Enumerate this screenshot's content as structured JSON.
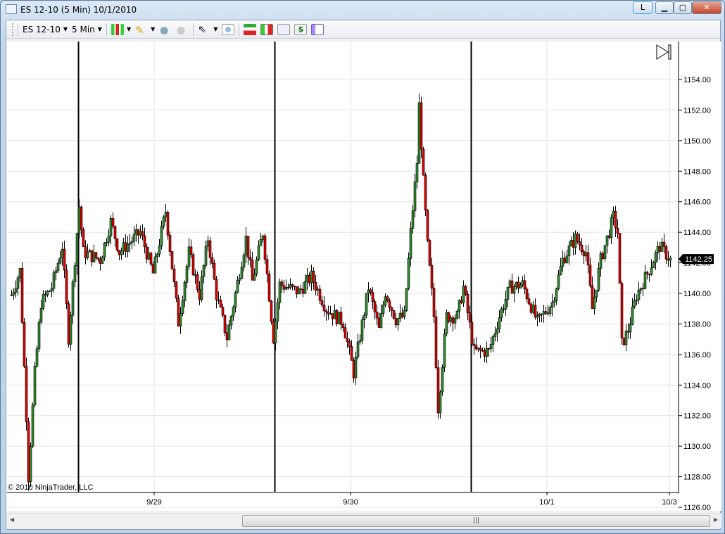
{
  "window": {
    "title": "ES 12-10 (5 Min)  10/1/2010",
    "link_button": "L"
  },
  "toolbar": {
    "instrument": "ES 12-10",
    "interval": "5 Min",
    "icons": [
      "chart-style-icon",
      "drawing-pencil-icon",
      "zoom-in-icon",
      "zoom-out-icon",
      "cursor-icon",
      "magnify-icon",
      "strategies-icon",
      "indicators-icon",
      "data-box-icon",
      "order-icon",
      "properties-icon"
    ]
  },
  "chart": {
    "copyright": "© 2010 NinjaTrader, LLC",
    "last_price": "1142.25",
    "up_color": "#2e8b2e",
    "down_color": "#e00000",
    "wick_color": "#000000",
    "last_price_bg": "#000000"
  },
  "chart_data": {
    "type": "candlestick",
    "ylim": [
      1126,
      1154
    ],
    "y_ticks": [
      "1126.00",
      "1128.00",
      "1130.00",
      "1132.00",
      "1134.00",
      "1136.00",
      "1138.00",
      "1140.00",
      "1142.00",
      "1144.00",
      "1146.00",
      "1148.00",
      "1150.00",
      "1152.00",
      "1154.00"
    ],
    "x_ticks": [
      {
        "label": "9/29",
        "bar": 69
      },
      {
        "label": "9/30",
        "bar": 162
      },
      {
        "label": "10/1",
        "bar": 255
      },
      {
        "label": "10/3",
        "bar": 313
      }
    ],
    "session_breaks": [
      33,
      126,
      219
    ],
    "grid": true,
    "price_path": [
      [
        1,
        1139.9
      ],
      [
        5,
        1141.5
      ],
      [
        8,
        1132
      ],
      [
        9,
        1128
      ],
      [
        12,
        1134.8
      ],
      [
        15,
        1139.4
      ],
      [
        20,
        1140.4
      ],
      [
        25,
        1143.1
      ],
      [
        28,
        1137.1
      ],
      [
        33,
        1145.7
      ],
      [
        35,
        1142.7
      ],
      [
        43,
        1142.2
      ],
      [
        48,
        1144.7
      ],
      [
        52,
        1142.7
      ],
      [
        62,
        1144
      ],
      [
        68,
        1141.3
      ],
      [
        74,
        1145.4
      ],
      [
        80,
        1138.1
      ],
      [
        85,
        1142.7
      ],
      [
        90,
        1139.9
      ],
      [
        94,
        1143.6
      ],
      [
        98,
        1139.9
      ],
      [
        103,
        1137.1
      ],
      [
        112,
        1143.6
      ],
      [
        115,
        1140.8
      ],
      [
        120,
        1144
      ],
      [
        125,
        1137.1
      ],
      [
        128,
        1140.6
      ],
      [
        137,
        1140.1
      ],
      [
        143,
        1141.1
      ],
      [
        150,
        1139
      ],
      [
        158,
        1138.1
      ],
      [
        163,
        1134.8
      ],
      [
        170,
        1140.4
      ],
      [
        175,
        1137.6
      ],
      [
        178,
        1140.1
      ],
      [
        183,
        1138.3
      ],
      [
        187,
        1138.5
      ],
      [
        190,
        1144
      ],
      [
        193,
        1148.6
      ],
      [
        194,
        1152.3
      ],
      [
        196,
        1147.3
      ],
      [
        198,
        1143.1
      ],
      [
        201,
        1138.5
      ],
      [
        203,
        1132.5
      ],
      [
        207,
        1138.5
      ],
      [
        212,
        1138.5
      ],
      [
        215,
        1140.4
      ],
      [
        220,
        1136.2
      ],
      [
        227,
        1136.2
      ],
      [
        232,
        1138.5
      ],
      [
        237,
        1140.4
      ],
      [
        243,
        1140.6
      ],
      [
        250,
        1138.1
      ],
      [
        257,
        1139.4
      ],
      [
        262,
        1142.2
      ],
      [
        268,
        1143.6
      ],
      [
        273,
        1142.7
      ],
      [
        276,
        1139
      ],
      [
        280,
        1142.2
      ],
      [
        286,
        1145
      ],
      [
        288,
        1144
      ],
      [
        290,
        1136.7
      ],
      [
        293,
        1137.6
      ],
      [
        297,
        1139.9
      ],
      [
        302,
        1141.3
      ],
      [
        308,
        1143.1
      ],
      [
        313,
        1142.2
      ]
    ]
  }
}
